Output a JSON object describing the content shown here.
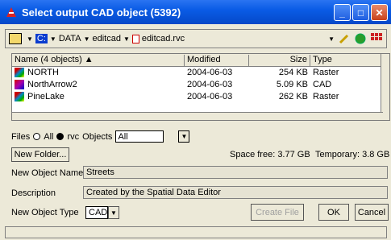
{
  "window": {
    "title": "Select output CAD object (5392)"
  },
  "path": {
    "drive": "C:",
    "folders": [
      "DATA",
      "editcad"
    ],
    "file": "editcad.rvc"
  },
  "list": {
    "headers": {
      "name": "Name (4 objects) ▲",
      "modified": "Modified",
      "size": "Size",
      "type": "Type"
    },
    "rows": [
      {
        "name": "NORTH",
        "modified": "2004-06-03",
        "size": "254 KB",
        "type": "Raster"
      },
      {
        "name": "NorthArrow2",
        "modified": "2004-06-03",
        "size": "5.09 KB",
        "type": "CAD"
      },
      {
        "name": "PineLake",
        "modified": "2004-06-03",
        "size": "262 KB",
        "type": "Raster"
      }
    ]
  },
  "filter": {
    "files_label": "Files",
    "all_label": "All",
    "rvc_label": "rvc",
    "objects_label": "Objects",
    "objects_value": "All"
  },
  "new_folder_label": "New Folder...",
  "space": {
    "free": "Space free: 3.77 GB",
    "temp": "Temporary: 3.8 GB"
  },
  "form": {
    "name_label": "New Object Name",
    "name_value": "Streets",
    "desc_label": "Description",
    "desc_value": "Created by the Spatial Data Editor",
    "type_label": "New Object Type",
    "type_value": "CAD"
  },
  "buttons": {
    "create": "Create File",
    "ok": "OK",
    "cancel": "Cancel"
  },
  "colors": {
    "title_bar": "#0a5ce6",
    "selection": "#0a3ccf"
  }
}
